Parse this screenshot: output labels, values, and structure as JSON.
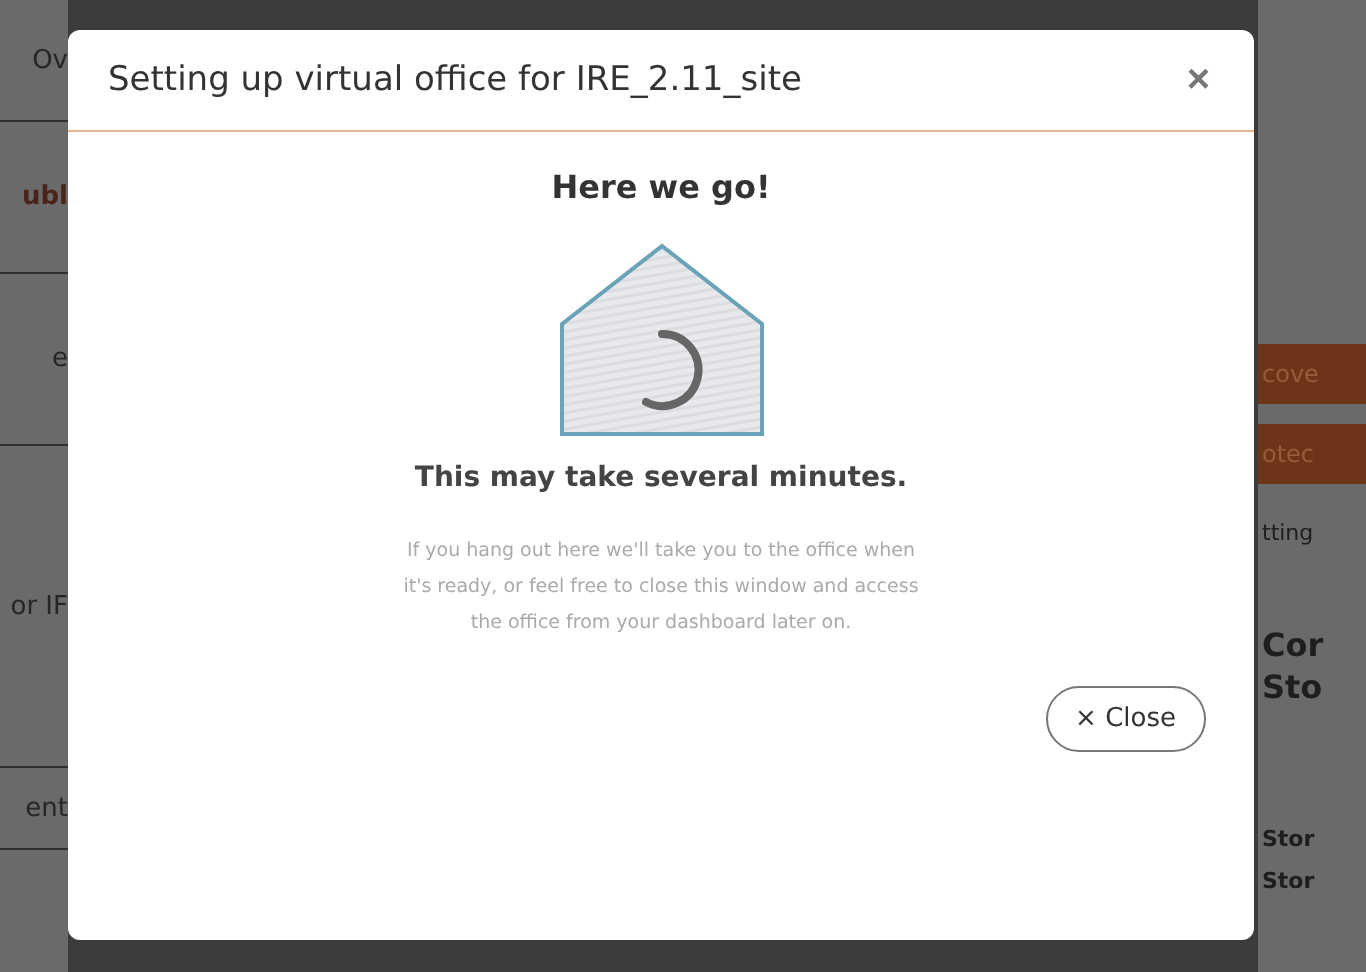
{
  "background": {
    "left_items": [
      {
        "text": "Ov",
        "kind": "plain"
      },
      {
        "text": "ubl",
        "kind": "accent"
      },
      {
        "text": "e",
        "kind": "plain"
      },
      {
        "text": "or IF",
        "kind": "plain"
      },
      {
        "text": "ent",
        "kind": "plain"
      }
    ],
    "right_items": [
      {
        "text": "cove",
        "kind": "button"
      },
      {
        "text": "otec",
        "kind": "button"
      },
      {
        "text": "tting",
        "kind": "plain"
      },
      {
        "text": "Cor",
        "kind": "heading"
      },
      {
        "text": "Sto",
        "kind": "heading"
      },
      {
        "text": "Stor",
        "kind": "bold"
      },
      {
        "text": "Stor",
        "kind": "bold"
      }
    ]
  },
  "dialog": {
    "title": "Setting up virtual office for IRE_2.11_site",
    "close_icon": "×",
    "heading": "Here we go!",
    "subtitle": "This may take several minutes.",
    "message": "If you hang out here we'll take you to the office when it's ready, or feel free to close this window and access the office from your dashboard later on.",
    "close_button": "× Close"
  }
}
